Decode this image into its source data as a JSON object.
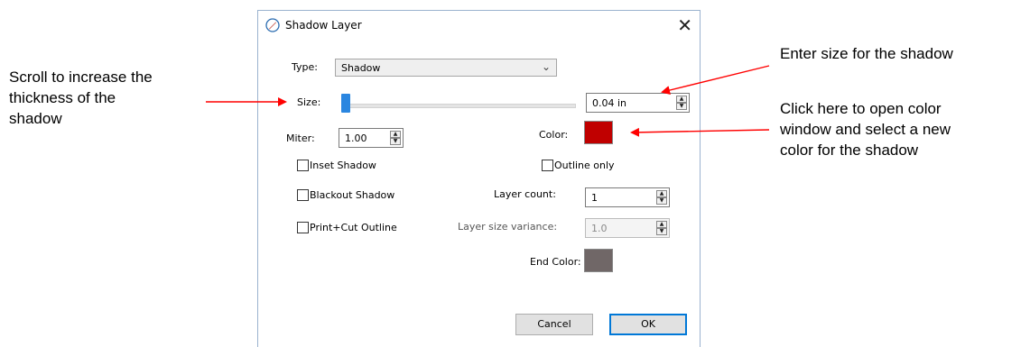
{
  "annotations": {
    "left_line1": "Scroll to increase the",
    "left_line2": "thickness of the",
    "left_line3": "shadow",
    "top_right": "Enter size for the shadow",
    "right_line1": "Click here to open color",
    "right_line2": "window and select a new",
    "right_line3": "color for the shadow",
    "arrow_color": "#ff0000"
  },
  "dialog": {
    "title": "Shadow Layer",
    "close_glyph": "✕",
    "type_label": "Type:",
    "type_value": "Shadow",
    "size_label": "Size:",
    "size_value": "0.04 in",
    "miter_label": "Miter:",
    "miter_value": "1.00",
    "color_label": "Color:",
    "color_value": "#c00000",
    "inset_shadow_label": "Inset Shadow",
    "outline_only_label": "Outline only",
    "blackout_shadow_label": "Blackout Shadow",
    "layer_count_label": "Layer count:",
    "layer_count_value": "1",
    "print_cut_label": "Print+Cut Outline",
    "layer_size_variance_label": "Layer size variance:",
    "layer_size_variance_value": "1.0",
    "end_color_label": "End Color:",
    "end_color_value": "#706767",
    "cancel_label": "Cancel",
    "ok_label": "OK",
    "accent_color": "#0078d7"
  }
}
